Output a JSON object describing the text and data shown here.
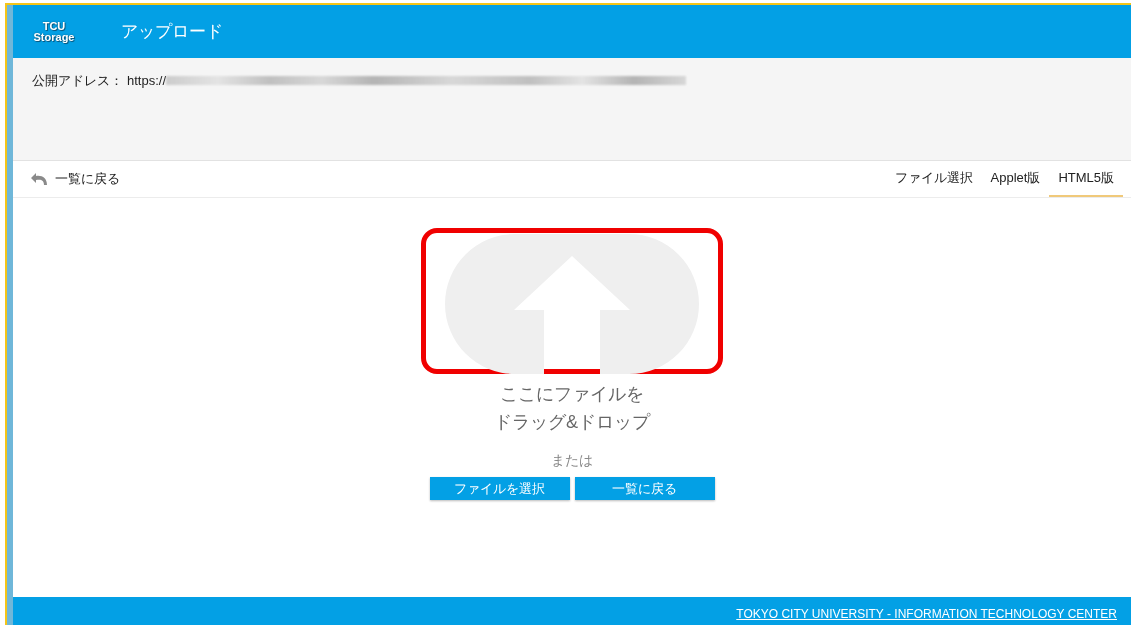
{
  "header": {
    "logo": [
      "TCU",
      "Storage"
    ],
    "title": "アップロード"
  },
  "address": {
    "label": "公開アドレス：",
    "value": "https://",
    "redacted": true
  },
  "toolbar": {
    "back": "一覧に戻る",
    "tabs": [
      {
        "label": "ファイル選択",
        "selected": false
      },
      {
        "label": "Applet版",
        "selected": false
      },
      {
        "label": "HTML5版",
        "selected": true
      }
    ]
  },
  "dropzone": {
    "highlighted": true,
    "lines": [
      "ここにファイルを",
      "ドラッグ&ドロップ"
    ],
    "or": "または",
    "buttons": [
      "ファイルを選択",
      "一覧に戻る"
    ]
  },
  "footer": {
    "link": "TOKYO CITY UNIVERSITY - INFORMATION TECHNOLOGY CENTER"
  }
}
